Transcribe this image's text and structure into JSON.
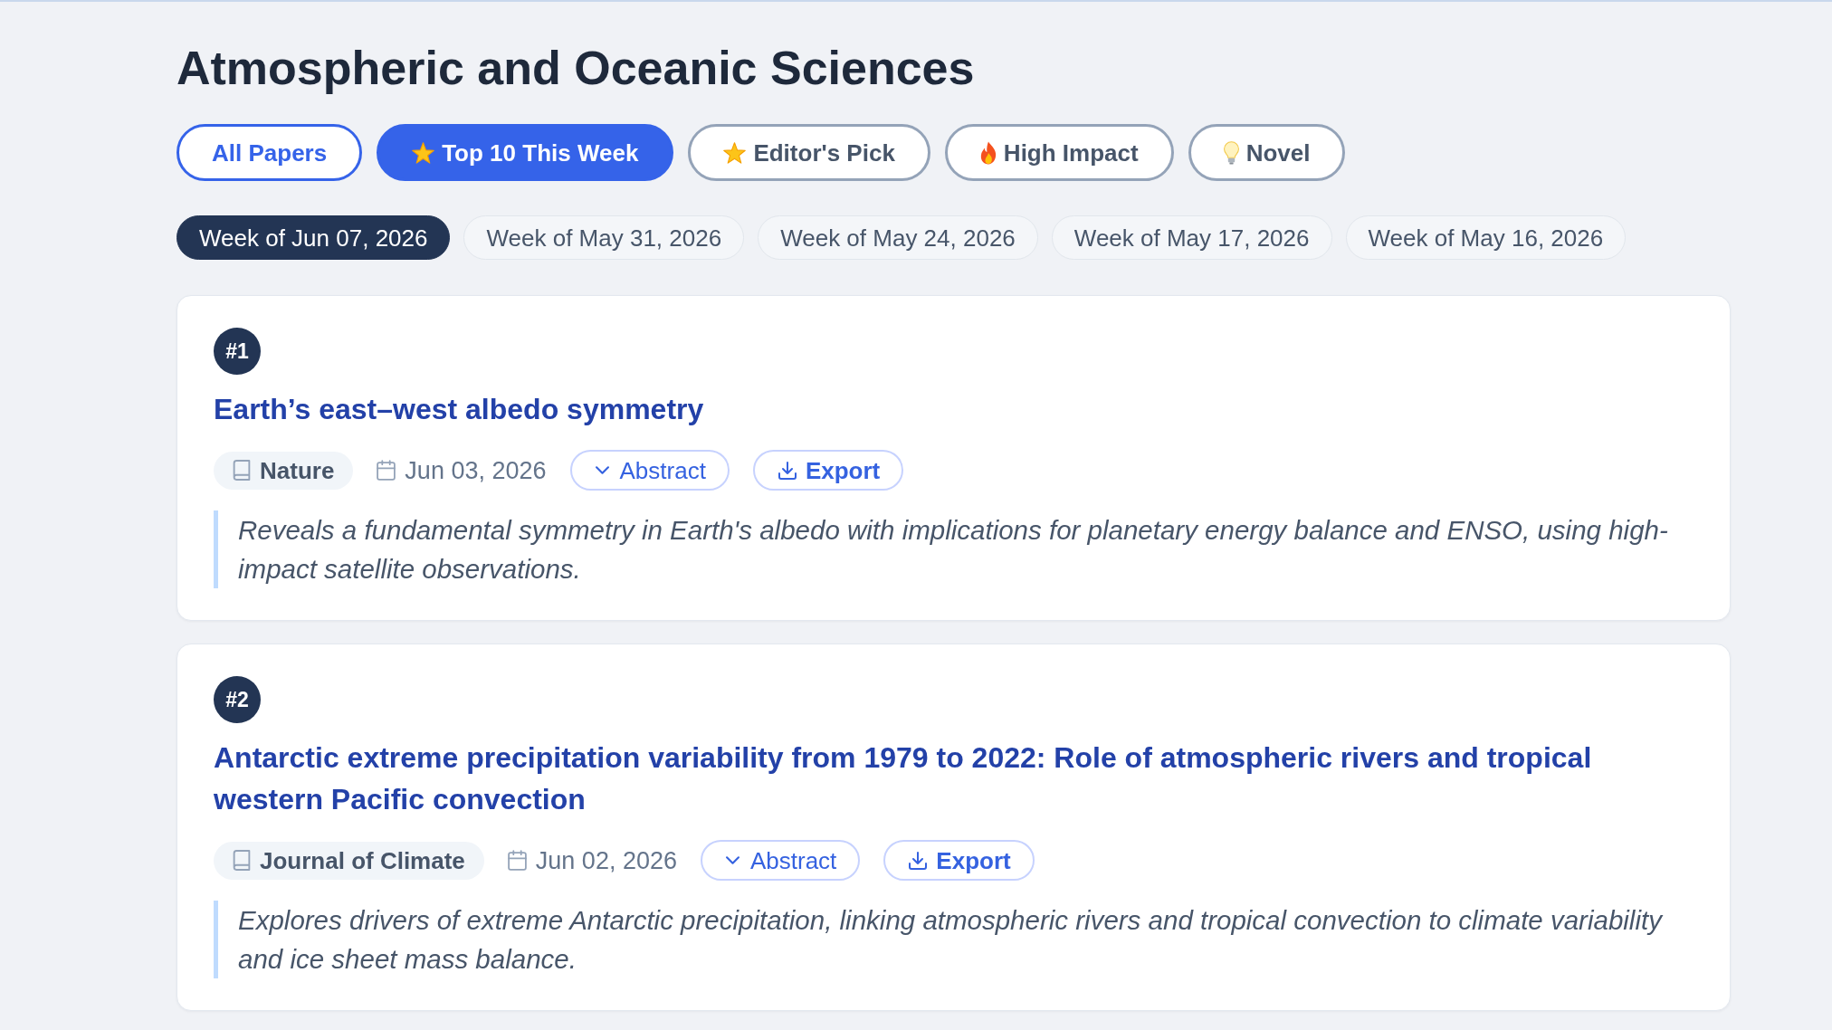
{
  "page": {
    "title": "Atmospheric and Oceanic Sciences"
  },
  "filters": [
    {
      "label": "All Papers",
      "kind": "all",
      "selected": false
    },
    {
      "label": "Top 10 This Week",
      "kind": "top",
      "selected": true
    },
    {
      "label": "Editor's Pick",
      "kind": "editor",
      "selected": false
    },
    {
      "label": "High Impact",
      "kind": "impact",
      "selected": false
    },
    {
      "label": "Novel",
      "kind": "novel",
      "selected": false
    }
  ],
  "weeks": [
    {
      "label": "Week of Jun 07, 2026",
      "selected": true
    },
    {
      "label": "Week of May 31, 2026",
      "selected": false
    },
    {
      "label": "Week of May 24, 2026",
      "selected": false
    },
    {
      "label": "Week of May 17, 2026",
      "selected": false
    },
    {
      "label": "Week of May 16, 2026",
      "selected": false
    }
  ],
  "papers": [
    {
      "rank": "#1",
      "title": "Earth’s east–west albedo symmetry",
      "journal": "Nature",
      "date": "Jun 03, 2026",
      "abstract_button": "Abstract",
      "export_button": "Export",
      "summary": "Reveals a fundamental symmetry in Earth's albedo with implications for planetary energy balance and ENSO, using high-impact satellite observations."
    },
    {
      "rank": "#2",
      "title": "Antarctic extreme precipitation variability from 1979 to 2022: Role of atmospheric rivers and tropical western Pacific convection",
      "journal": "Journal of Climate",
      "date": "Jun 02, 2026",
      "abstract_button": "Abstract",
      "export_button": "Export",
      "summary": "Explores drivers of extreme Antarctic precipitation, linking atmospheric rivers and tropical convection to climate variability and ice sheet mass balance."
    }
  ]
}
